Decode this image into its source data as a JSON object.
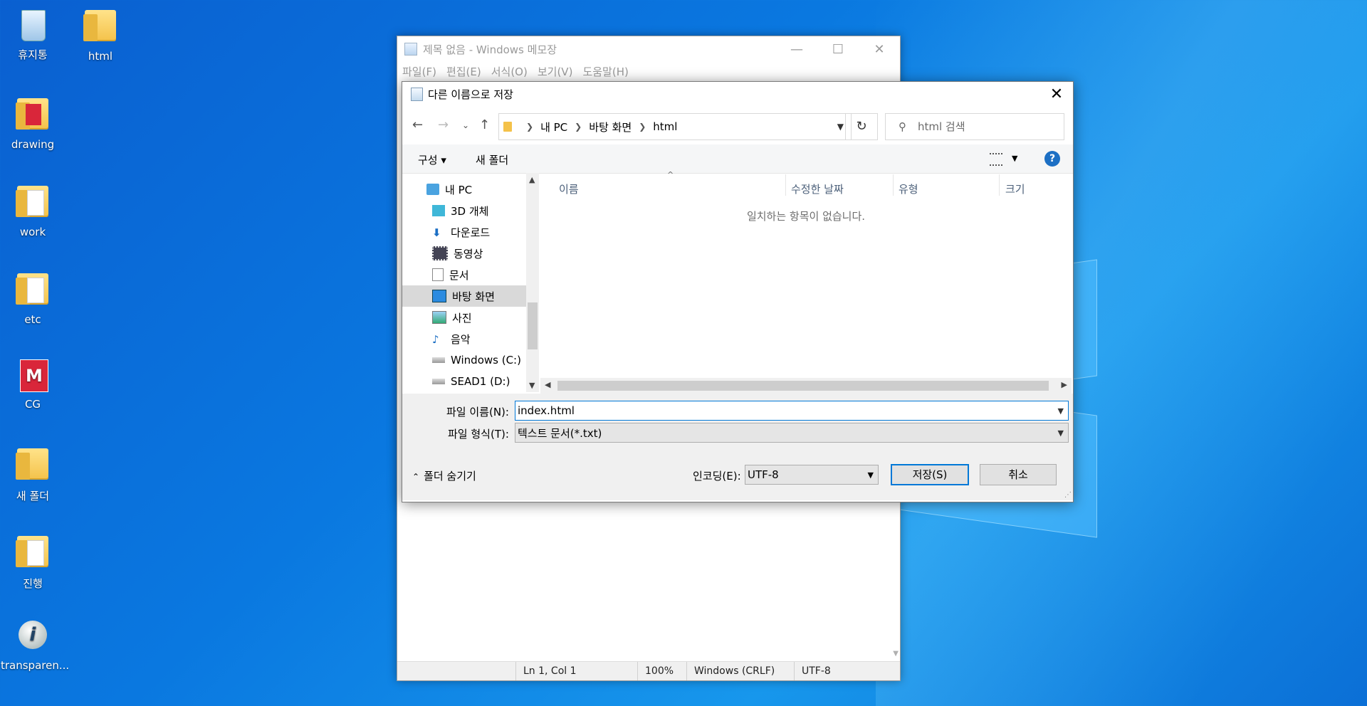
{
  "desktop": {
    "icons": [
      {
        "label": "휴지통",
        "icon": "recycle-bin-icon"
      },
      {
        "label": "html",
        "icon": "folder-icon"
      },
      {
        "label": "drawing",
        "icon": "folder-icon"
      },
      {
        "label": "work",
        "icon": "folder-icon"
      },
      {
        "label": "etc",
        "icon": "folder-icon"
      },
      {
        "label": "CG",
        "icon": "app-icon"
      },
      {
        "label": "새 폴더",
        "icon": "folder-icon"
      },
      {
        "label": "진행",
        "icon": "folder-icon"
      },
      {
        "label": "transparen...",
        "icon": "info-balloon-icon"
      }
    ]
  },
  "notepad": {
    "title": "제목 없음 - Windows 메모장",
    "menu": [
      "파일(F)",
      "편집(E)",
      "서식(O)",
      "보기(V)",
      "도움말(H)"
    ],
    "status": {
      "position": "Ln 1, Col 1",
      "zoom": "100%",
      "line_ending": "Windows (CRLF)",
      "encoding": "UTF-8"
    }
  },
  "dialog": {
    "title": "다른 이름으로 저장",
    "close_glyph": "✕",
    "address": [
      "내 PC",
      "바탕 화면",
      "html"
    ],
    "search_placeholder": "html 검색",
    "toolbar": {
      "organize": "구성 ▾",
      "new_folder": "새 폴더",
      "help": "?"
    },
    "nav_items": [
      {
        "label": "내 PC",
        "icon": "computer-icon"
      },
      {
        "label": "3D 개체",
        "icon": "cube-icon"
      },
      {
        "label": "다운로드",
        "icon": "download-icon"
      },
      {
        "label": "동영상",
        "icon": "video-icon"
      },
      {
        "label": "문서",
        "icon": "document-icon"
      },
      {
        "label": "바탕 화면",
        "icon": "desktop-icon",
        "selected": true
      },
      {
        "label": "사진",
        "icon": "pictures-icon"
      },
      {
        "label": "음악",
        "icon": "music-icon"
      },
      {
        "label": "Windows (C:)",
        "icon": "drive-icon"
      },
      {
        "label": "SEAD1 (D:)",
        "icon": "drive-icon"
      }
    ],
    "columns": [
      "이름",
      "수정한 날짜",
      "유형",
      "크기"
    ],
    "empty_message": "일치하는 항목이 없습니다.",
    "filename_label": "파일 이름(N):",
    "filename_value": "index.html",
    "filetype_label": "파일 형식(T):",
    "filetype_value": "텍스트 문서(*.txt)",
    "hide_folders": "폴더 숨기기",
    "encoding_label": "인코딩(E):",
    "encoding_value": "UTF-8",
    "save_button": "저장(S)",
    "cancel_button": "취소"
  },
  "colors": {
    "desktop": "#0a78e0",
    "accent": "#0078d7"
  }
}
